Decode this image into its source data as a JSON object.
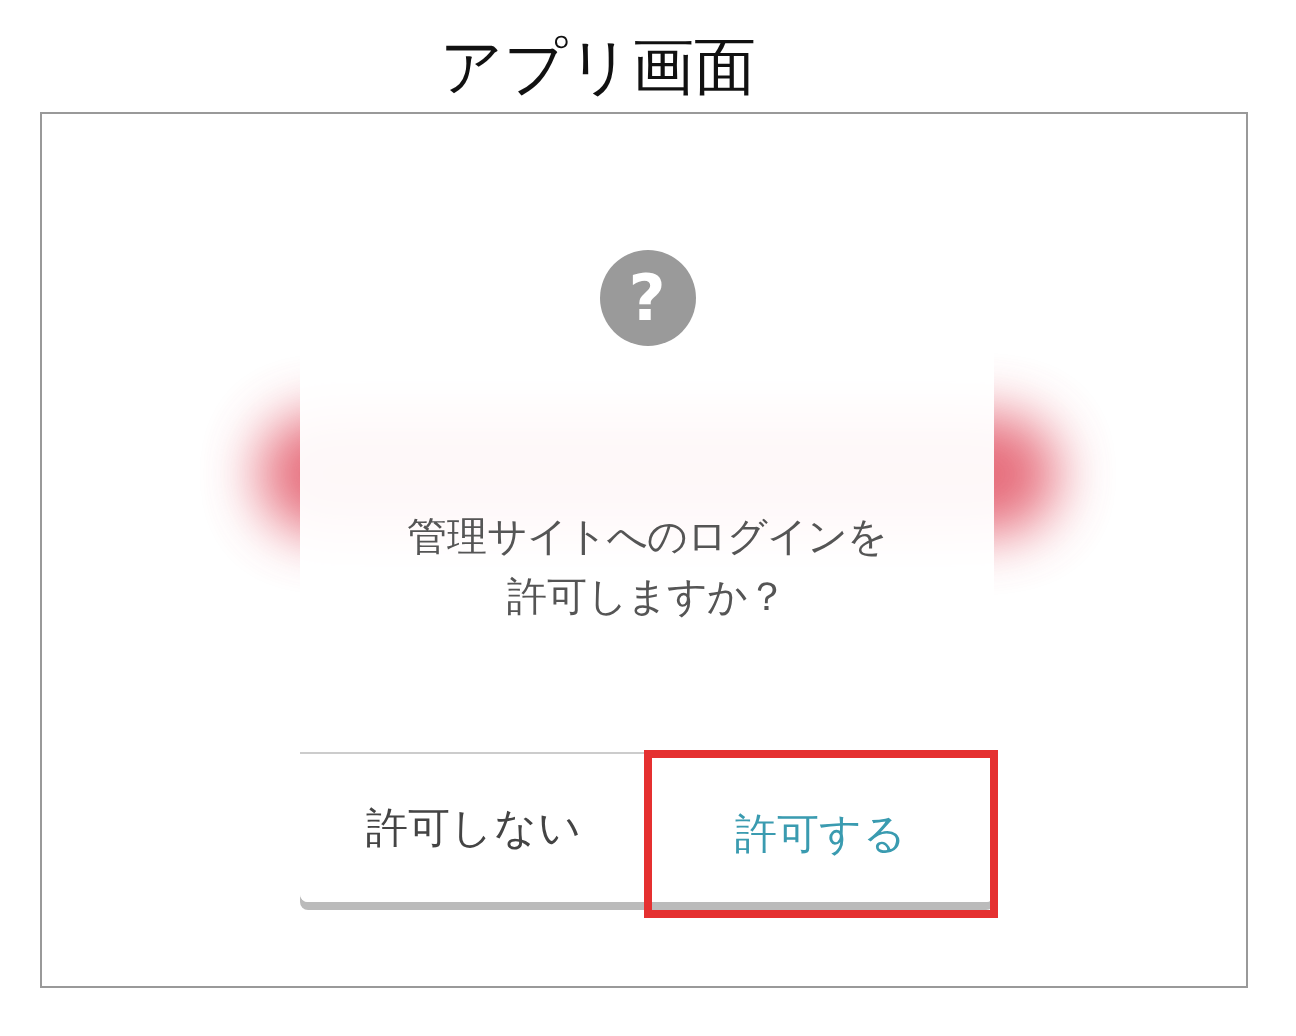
{
  "caption": "アプリ画面",
  "dialog": {
    "icon_glyph": "?",
    "message_lines": [
      "管理サイトへのログインを",
      "許可しますか？"
    ],
    "buttons": [
      {
        "label": "許可しない",
        "kind": "neutral",
        "highlighted": false
      },
      {
        "label": "許可する",
        "kind": "accent",
        "highlighted": true
      }
    ]
  }
}
